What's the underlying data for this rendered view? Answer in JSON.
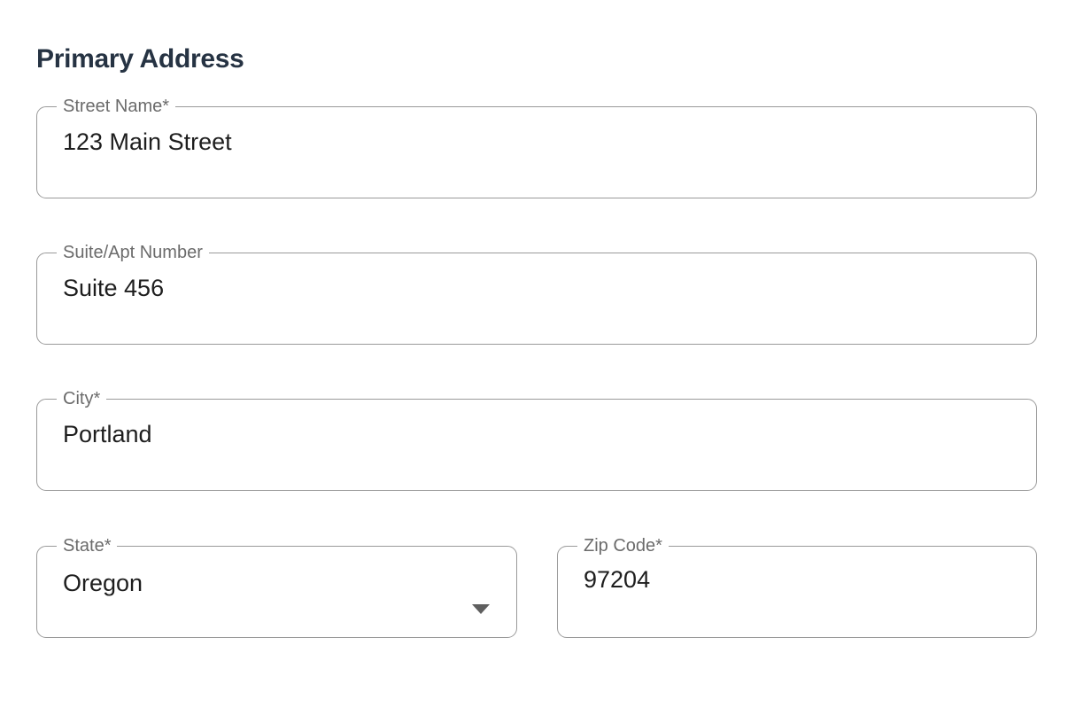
{
  "section": {
    "title": "Primary Address"
  },
  "fields": {
    "street": {
      "label": "Street Name*",
      "value": "123 Main Street"
    },
    "suite": {
      "label": "Suite/Apt Number",
      "value": "Suite 456"
    },
    "city": {
      "label": "City*",
      "value": "Portland"
    },
    "state": {
      "label": "State*",
      "value": "Oregon",
      "icon": "caret-down-icon"
    },
    "zip": {
      "label": "Zip Code*",
      "value": "97204"
    }
  },
  "colors": {
    "title": "#263343",
    "border": "#9a9a9a",
    "label": "#6b6b6b",
    "value": "#1e1e1e"
  }
}
